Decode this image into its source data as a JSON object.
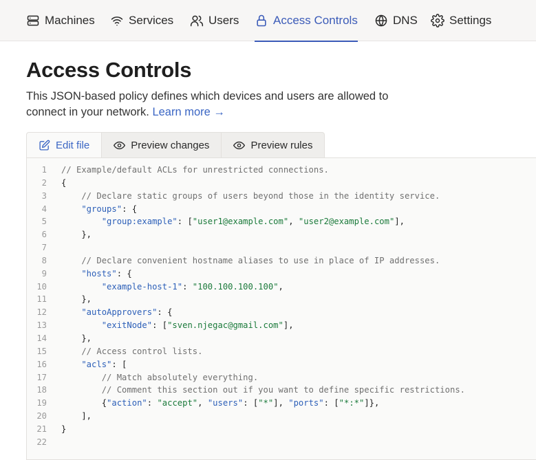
{
  "nav": {
    "items": [
      {
        "label": "Machines",
        "icon": "machines-icon"
      },
      {
        "label": "Services",
        "icon": "wifi-icon"
      },
      {
        "label": "Users",
        "icon": "users-icon"
      },
      {
        "label": "Access Controls",
        "icon": "lock-icon",
        "active": true
      },
      {
        "label": "DNS",
        "icon": "globe-icon"
      },
      {
        "label": "Settings",
        "icon": "gear-icon"
      }
    ],
    "accent_color": "#3b5bb8"
  },
  "page": {
    "title": "Access Controls",
    "description": "This JSON-based policy defines which devices and users are allowed to connect in your network.",
    "learn_more": "Learn more →"
  },
  "tabs": [
    {
      "label": "Edit file",
      "icon": "edit-icon",
      "active": true
    },
    {
      "label": "Preview changes",
      "icon": "eye-icon"
    },
    {
      "label": "Preview rules",
      "icon": "eye-icon"
    }
  ],
  "editor": {
    "line_numbers": [
      "1",
      "2",
      "3",
      "4",
      "5",
      "6",
      "7",
      "8",
      "9",
      "10",
      "11",
      "12",
      "13",
      "14",
      "15",
      "16",
      "17",
      "18",
      "19",
      "20",
      "21",
      "22"
    ],
    "lines": [
      [
        {
          "t": "cm",
          "v": "// Example/default ACLs for unrestricted connections."
        }
      ],
      [
        {
          "t": "p",
          "v": "{"
        }
      ],
      [
        {
          "t": "cm",
          "v": "    // Declare static groups of users beyond those in the identity service."
        }
      ],
      [
        {
          "t": "key",
          "v": "    \"groups\""
        },
        {
          "t": "p",
          "v": ": {"
        }
      ],
      [
        {
          "t": "key",
          "v": "        \"group:example\""
        },
        {
          "t": "p",
          "v": ": ["
        },
        {
          "t": "str",
          "v": "\"user1@example.com\""
        },
        {
          "t": "p",
          "v": ", "
        },
        {
          "t": "str",
          "v": "\"user2@example.com\""
        },
        {
          "t": "p",
          "v": "],"
        }
      ],
      [
        {
          "t": "p",
          "v": "    },"
        }
      ],
      [
        {
          "t": "p",
          "v": ""
        }
      ],
      [
        {
          "t": "cm",
          "v": "    // Declare convenient hostname aliases to use in place of IP addresses."
        }
      ],
      [
        {
          "t": "key",
          "v": "    \"hosts\""
        },
        {
          "t": "p",
          "v": ": {"
        }
      ],
      [
        {
          "t": "key",
          "v": "        \"example-host-1\""
        },
        {
          "t": "p",
          "v": ": "
        },
        {
          "t": "str",
          "v": "\"100.100.100.100\""
        },
        {
          "t": "p",
          "v": ","
        }
      ],
      [
        {
          "t": "p",
          "v": "    },"
        }
      ],
      [
        {
          "t": "key",
          "v": "    \"autoApprovers\""
        },
        {
          "t": "p",
          "v": ": {"
        }
      ],
      [
        {
          "t": "key",
          "v": "        \"exitNode\""
        },
        {
          "t": "p",
          "v": ": ["
        },
        {
          "t": "str",
          "v": "\"sven.njegac@gmail.com\""
        },
        {
          "t": "p",
          "v": "],"
        }
      ],
      [
        {
          "t": "p",
          "v": "    },"
        }
      ],
      [
        {
          "t": "cm",
          "v": "    // Access control lists."
        }
      ],
      [
        {
          "t": "key",
          "v": "    \"acls\""
        },
        {
          "t": "p",
          "v": ": ["
        }
      ],
      [
        {
          "t": "cm",
          "v": "        // Match absolutely everything."
        }
      ],
      [
        {
          "t": "cm",
          "v": "        // Comment this section out if you want to define specific restrictions."
        }
      ],
      [
        {
          "t": "p",
          "v": "        {"
        },
        {
          "t": "key",
          "v": "\"action\""
        },
        {
          "t": "p",
          "v": ": "
        },
        {
          "t": "str",
          "v": "\"accept\""
        },
        {
          "t": "p",
          "v": ", "
        },
        {
          "t": "key",
          "v": "\"users\""
        },
        {
          "t": "p",
          "v": ": ["
        },
        {
          "t": "str",
          "v": "\"*\""
        },
        {
          "t": "p",
          "v": "], "
        },
        {
          "t": "key",
          "v": "\"ports\""
        },
        {
          "t": "p",
          "v": ": ["
        },
        {
          "t": "str",
          "v": "\"*:*\""
        },
        {
          "t": "p",
          "v": "]},"
        }
      ],
      [
        {
          "t": "p",
          "v": "    ],"
        }
      ],
      [
        {
          "t": "p",
          "v": "}"
        }
      ],
      [
        {
          "t": "p",
          "v": ""
        }
      ]
    ]
  }
}
